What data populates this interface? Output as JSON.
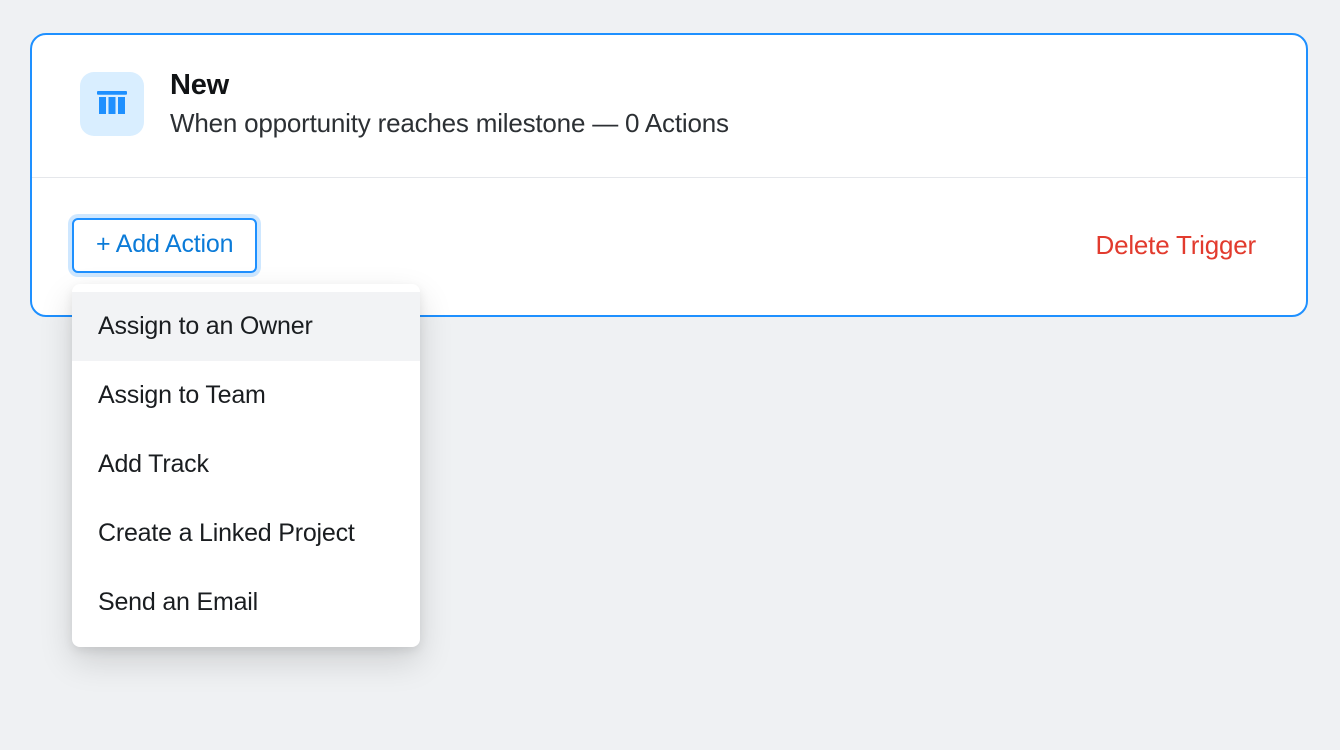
{
  "trigger": {
    "title": "New",
    "subtitle": "When opportunity reaches milestone — 0 Actions"
  },
  "footer": {
    "add_action_label": "+ Add Action",
    "delete_trigger_label": "Delete Trigger"
  },
  "dropdown": {
    "items": [
      "Assign to an Owner",
      "Assign to Team",
      "Add Track",
      "Create a Linked Project",
      "Send an Email"
    ],
    "highlighted_index": 0
  }
}
